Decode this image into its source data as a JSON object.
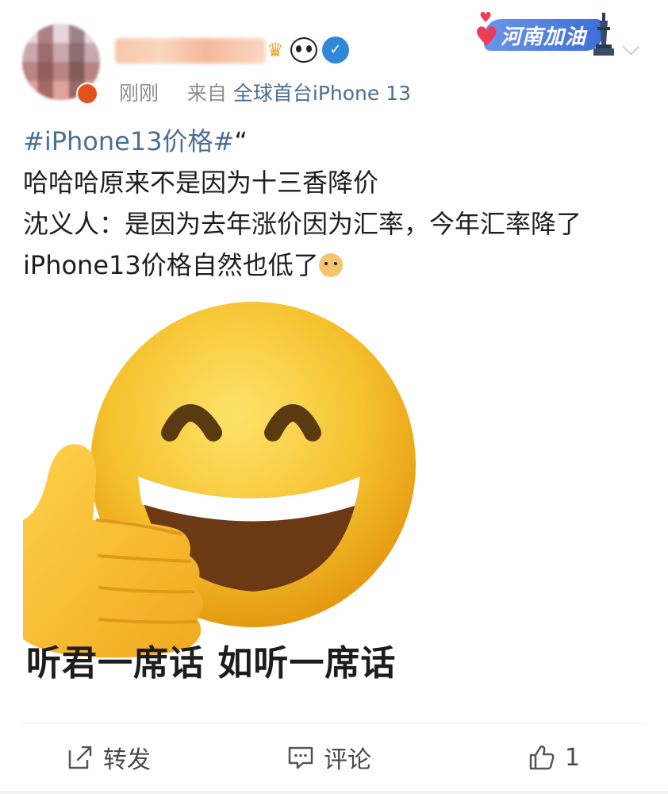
{
  "header": {
    "meta_time": "刚刚",
    "meta_from": "来自",
    "meta_source": "全球首台iPhone 13",
    "campaign_label": "河南加油"
  },
  "post": {
    "hashtag": "#iPhone13价格#",
    "quote_mark": "“",
    "lines": [
      "哈哈哈原来不是因为十三香降价",
      "沈义人：是因为去年涨价因为汇率，今年汇率降了",
      "iPhone13价格自然也低了"
    ]
  },
  "image": {
    "caption": "听君一席话 如听一席话"
  },
  "actions": {
    "repost_label": "转发",
    "comment_label": "评论",
    "like_count": "1"
  },
  "colors": {
    "link": "#4a6e94",
    "meta": "#8f8f8f",
    "campaign_blue": "#3f6ed8",
    "heart_red": "#ee3b56",
    "emoji_yellow": "#f6c22e"
  },
  "icons": {
    "verify": "verified-badge-icon",
    "crown": "crown-badge-icon",
    "panda": "panda-badge-icon",
    "chevron": "chevron-down-icon",
    "repost": "repost-icon",
    "comment": "comment-icon",
    "like": "thumbs-up-icon",
    "doge": "doge-emoji-icon"
  }
}
